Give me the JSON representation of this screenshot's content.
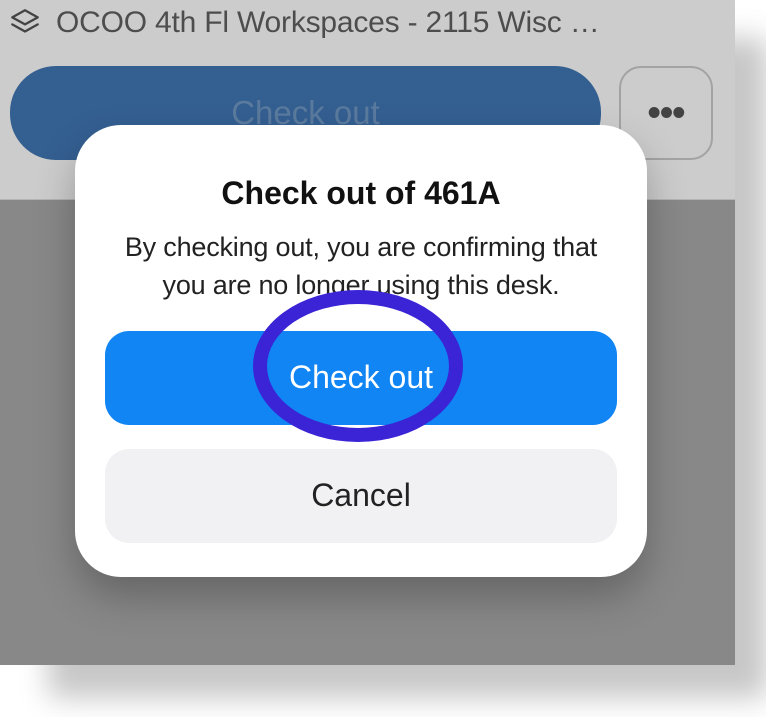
{
  "header": {
    "title": "OCOO 4th Fl Workspaces - 2115 Wisc …",
    "pill_label": "Check out"
  },
  "dialog": {
    "title": "Check out of 461A",
    "message": "By checking out, you are confirming that you are no longer using this desk.",
    "primary_label": "Check out",
    "secondary_label": "Cancel"
  }
}
